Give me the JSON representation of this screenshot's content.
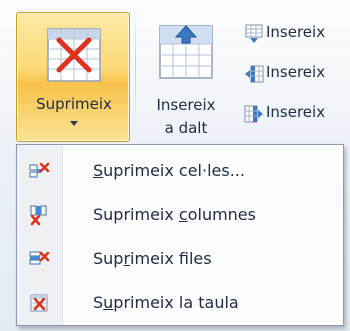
{
  "ribbon": {
    "delete_button": {
      "label": "Suprimeix",
      "icon": "delete-table-icon"
    },
    "insert_above_button": {
      "label_line1": "Insereix",
      "label_line2": "a dalt",
      "icon": "insert-above-icon"
    },
    "small_buttons": [
      {
        "label": "Insereix",
        "icon": "insert-below-icon"
      },
      {
        "label": "Insereix",
        "icon": "insert-left-icon"
      },
      {
        "label": "Insereix",
        "icon": "insert-right-icon"
      }
    ]
  },
  "delete_menu": {
    "items": [
      {
        "pre": "",
        "key": "S",
        "post": "uprimeix cel·les...",
        "icon": "delete-cells-icon"
      },
      {
        "pre": "Suprimeix ",
        "key": "c",
        "post": "olumnes",
        "icon": "delete-columns-icon"
      },
      {
        "pre": "Sup",
        "key": "r",
        "post": "imeix files",
        "icon": "delete-rows-icon"
      },
      {
        "pre": "S",
        "key": "u",
        "post": "primeix la taula",
        "icon": "delete-table-icon"
      }
    ]
  },
  "colors": {
    "highlight": "#fbd873",
    "highlight_border": "#c29b29",
    "text": "#1e2c44",
    "delete_red": "#e0301e",
    "insert_blue": "#3b78c4"
  }
}
